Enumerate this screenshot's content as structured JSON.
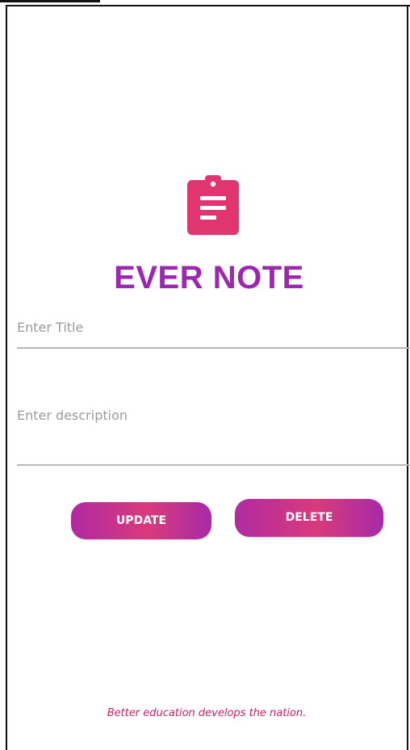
{
  "app": {
    "title": "EVER NOTE",
    "icon": "clipboard-icon",
    "accent_color": "#9c27b0",
    "icon_color": "#e0356e"
  },
  "form": {
    "title_placeholder": "Enter Title",
    "title_value": "",
    "description_placeholder": "Enter description",
    "description_value": ""
  },
  "actions": {
    "update_label": "UPDATE",
    "delete_label": "DELETE"
  },
  "footer": {
    "tagline": "Better education develops the nation."
  }
}
